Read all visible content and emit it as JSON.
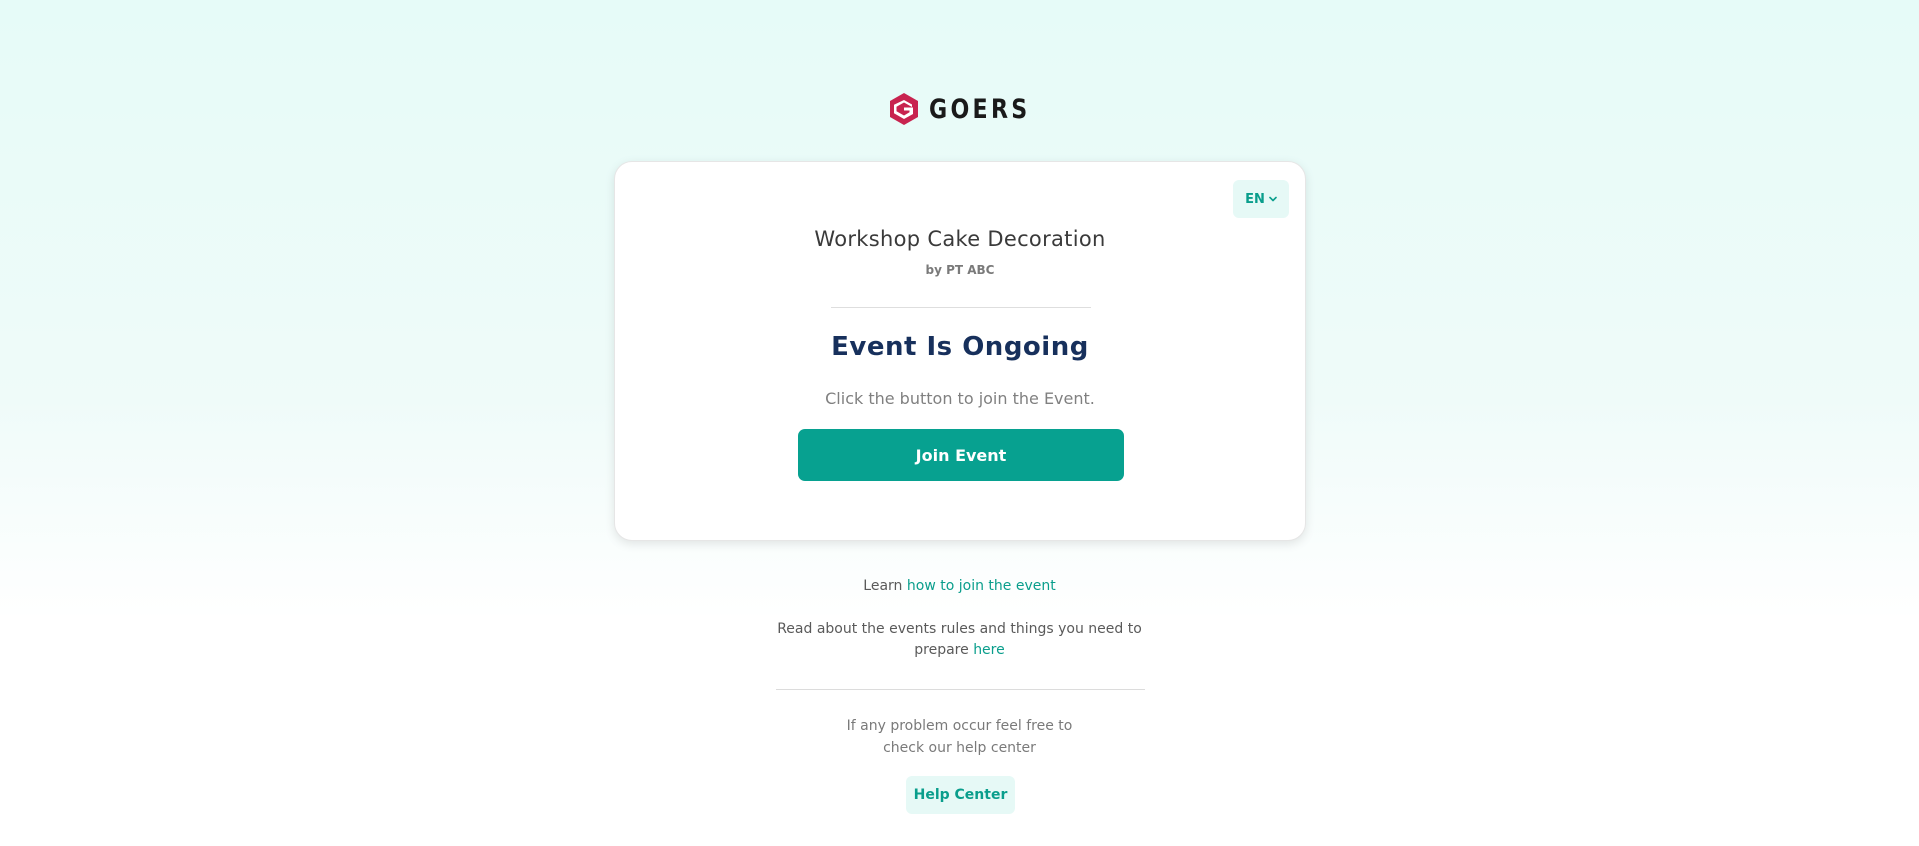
{
  "brand": {
    "name": "GOERS",
    "logo_icon": "goers-g-logo-icon",
    "logo_color": "#c8234f"
  },
  "card": {
    "language": {
      "label": "EN",
      "icon": "chevron-down-icon"
    },
    "event_title": "Workshop Cake Decoration",
    "organizer": "by PT ABC",
    "status": "Event Is Ongoing",
    "instruction": "Click the button to join the Event.",
    "join_button": "Join Event"
  },
  "info": {
    "learn_prefix": "Learn",
    "learn_link": "how to join the event",
    "rules_text": "Read about the events rules and things you need to prepare",
    "rules_link": "here",
    "help_text": "If any problem occur feel free to check our help center",
    "help_button": "Help Center"
  },
  "colors": {
    "accent": "#07a190",
    "accent_light": "#e6f9f6",
    "status_text": "#17305c",
    "brand": "#c8234f"
  }
}
